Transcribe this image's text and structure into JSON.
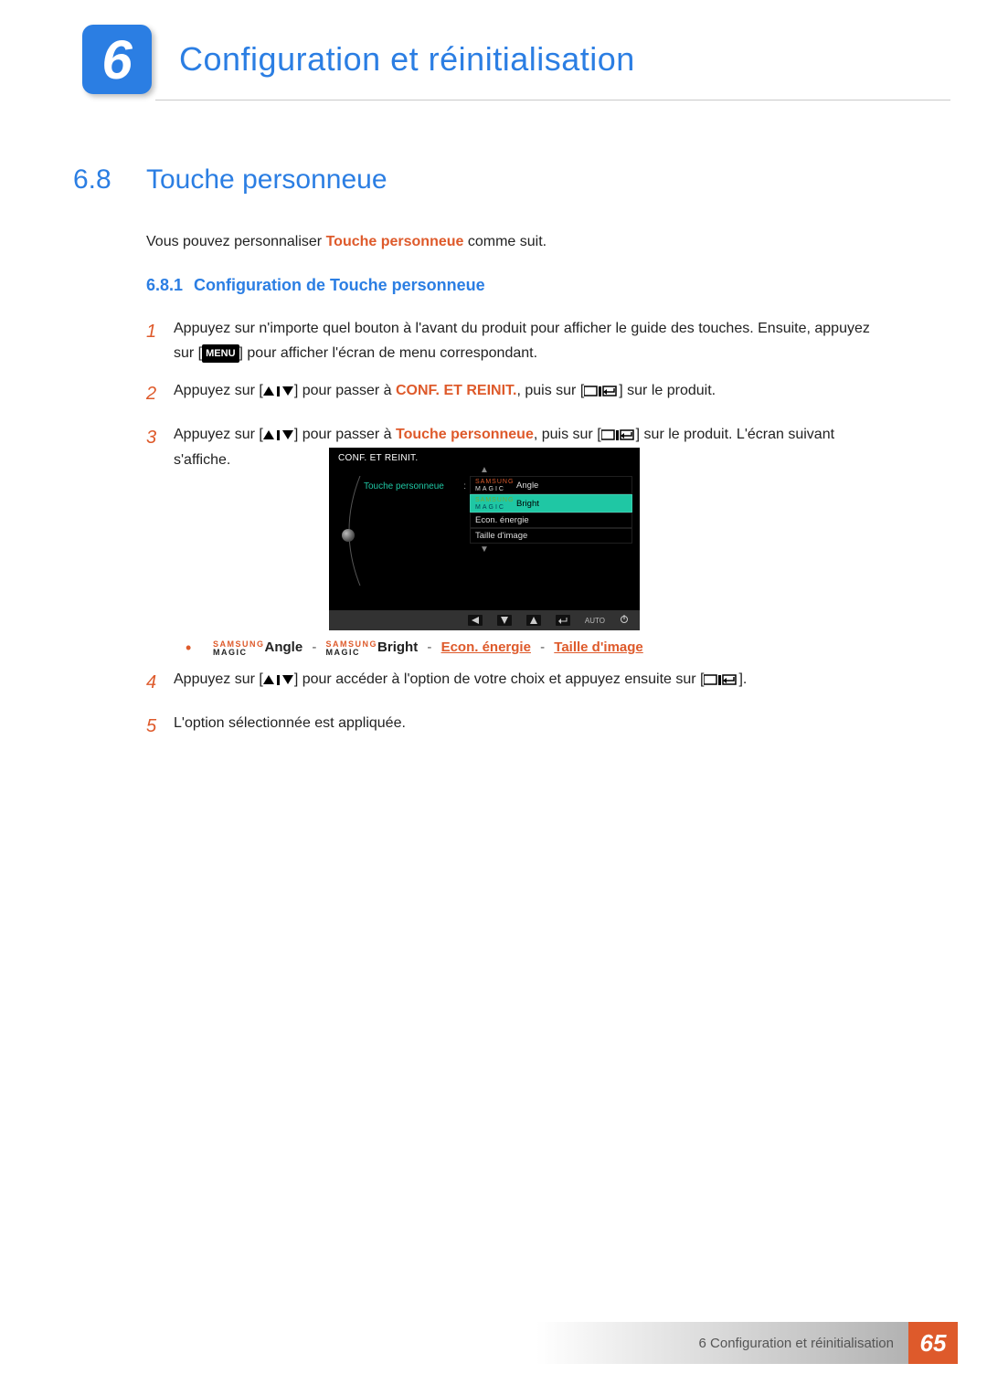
{
  "chapter": {
    "number": "6",
    "title": "Configuration et réinitialisation"
  },
  "section": {
    "number": "6.8",
    "title": "Touche personneue"
  },
  "intro": {
    "pre": "Vous pouvez personnaliser ",
    "kw": "Touche personneue",
    "post": " comme suit."
  },
  "subsection": {
    "number": "6.8.1",
    "title": "Configuration de Touche personneue"
  },
  "steps": {
    "s1": {
      "num": "1",
      "t1": "Appuyez sur n'importe quel bouton à l'avant du produit pour afficher le guide des touches. Ensuite, appuyez sur [",
      "menu": "MENU",
      "t2": "] pour afficher l'écran de menu correspondant."
    },
    "s2": {
      "num": "2",
      "t1": "Appuyez sur [",
      "t2": "] pour passer à ",
      "kw": "CONF. ET REINIT.",
      "t3": ", puis sur [",
      "t4": "] sur le produit."
    },
    "s3": {
      "num": "3",
      "t1": "Appuyez sur [",
      "t2": "] pour passer à ",
      "kw": "Touche personneue",
      "t3": ", puis sur [",
      "t4": "] sur le produit. L'écran suivant s'affiche."
    },
    "s4": {
      "num": "4",
      "t1": "Appuyez sur [",
      "t2": "] pour accéder à l'option de votre choix et appuyez ensuite sur [",
      "t3": "]."
    },
    "s5": {
      "num": "5",
      "t1": "L'option sélectionnée est appliquée."
    }
  },
  "osd": {
    "title": "CONF. ET REINIT.",
    "menuitem": "Touche personneue",
    "samsung": "SAMSUNG",
    "magic": "MAGIC",
    "opt_angle": "Angle",
    "opt_bright": "Bright",
    "opt_econ": "Econ. énergie",
    "opt_taille": "Taille d'image",
    "auto": "AUTO"
  },
  "bullets": {
    "samsung": "SAMSUNG",
    "magic": "MAGIC",
    "angle": "Angle",
    "bright": "Bright",
    "econ": "Econ. énergie",
    "taille": "Taille d'image",
    "sep": "-"
  },
  "footer": {
    "text": "6 Configuration et réinitialisation",
    "page": "65"
  }
}
